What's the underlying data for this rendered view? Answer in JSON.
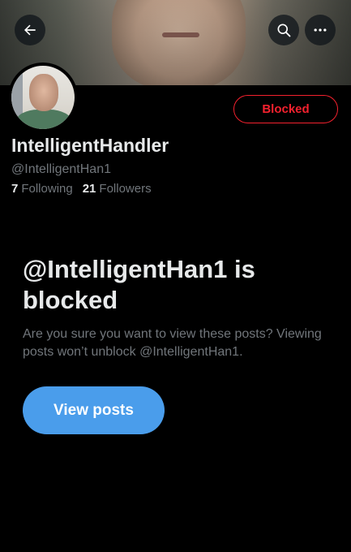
{
  "header": {
    "back_icon": "arrow-left-icon",
    "search_icon": "search-icon",
    "more_icon": "more-horizontal-icon"
  },
  "profile": {
    "display_name": "IntelligentHandler",
    "handle": "@IntelligentHan1",
    "following_count": "7",
    "following_label": "Following",
    "followers_count": "21",
    "followers_label": "Followers",
    "blocked_button_label": "Blocked"
  },
  "blocked_notice": {
    "title": "@IntelligentHan1 is blocked",
    "description": "Are you sure you want to view these posts? Viewing posts won’t unblock @IntelligentHan1.",
    "view_button_label": "View posts"
  },
  "colors": {
    "background": "#000000",
    "text_primary": "#e7e9ea",
    "text_secondary": "#71767b",
    "blocked_red": "#f4212e",
    "accent_blue": "#4a9deb"
  }
}
